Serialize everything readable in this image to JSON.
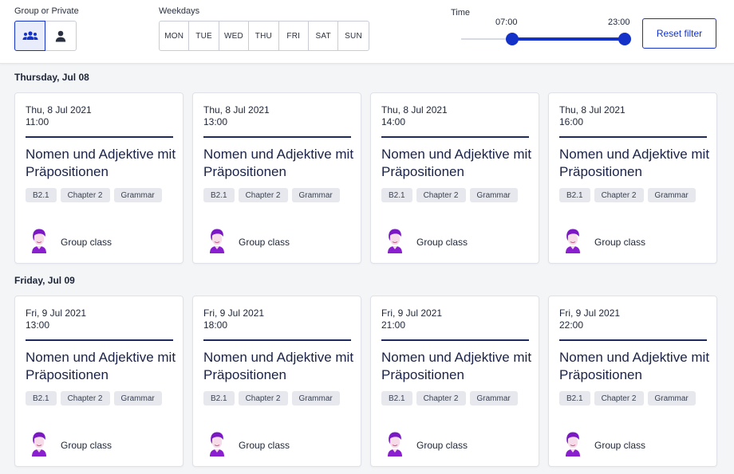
{
  "filters": {
    "group_label": "Group or Private",
    "weekdays_label": "Weekdays",
    "weekdays": [
      "MON",
      "TUE",
      "WED",
      "THU",
      "FRI",
      "SAT",
      "SUN"
    ],
    "time_label": "Time",
    "time_start": "07:00",
    "time_end": "23:00",
    "reset_label": "Reset filter"
  },
  "days": [
    {
      "heading": "Thursday, Jul 08",
      "cards": [
        {
          "date": "Thu, 8 Jul 2021",
          "time": "11:00",
          "title": "Nomen und Adjektive mit Präpositionen",
          "tags": [
            "B2.1",
            "Chapter 2",
            "Grammar"
          ],
          "kind": "Group class"
        },
        {
          "date": "Thu, 8 Jul 2021",
          "time": "13:00",
          "title": "Nomen und Adjektive mit Präpositionen",
          "tags": [
            "B2.1",
            "Chapter 2",
            "Grammar"
          ],
          "kind": "Group class"
        },
        {
          "date": "Thu, 8 Jul 2021",
          "time": "14:00",
          "title": "Nomen und Adjektive mit Präpositionen",
          "tags": [
            "B2.1",
            "Chapter 2",
            "Grammar"
          ],
          "kind": "Group class"
        },
        {
          "date": "Thu, 8 Jul 2021",
          "time": "16:00",
          "title": "Nomen und Adjektive mit Präpositionen",
          "tags": [
            "B2.1",
            "Chapter 2",
            "Grammar"
          ],
          "kind": "Group class"
        }
      ]
    },
    {
      "heading": "Friday, Jul 09",
      "cards": [
        {
          "date": "Fri, 9 Jul 2021",
          "time": "13:00",
          "title": "Nomen und Adjektive mit Präpositionen",
          "tags": [
            "B2.1",
            "Chapter 2",
            "Grammar"
          ],
          "kind": "Group class"
        },
        {
          "date": "Fri, 9 Jul 2021",
          "time": "18:00",
          "title": "Nomen und Adjektive mit Präpositionen",
          "tags": [
            "B2.1",
            "Chapter 2",
            "Grammar"
          ],
          "kind": "Group class"
        },
        {
          "date": "Fri, 9 Jul 2021",
          "time": "21:00",
          "title": "Nomen und Adjektive mit Präpositionen",
          "tags": [
            "B2.1",
            "Chapter 2",
            "Grammar"
          ],
          "kind": "Group class"
        },
        {
          "date": "Fri, 9 Jul 2021",
          "time": "22:00",
          "title": "Nomen und Adjektive mit Präpositionen",
          "tags": [
            "B2.1",
            "Chapter 2",
            "Grammar"
          ],
          "kind": "Group class"
        }
      ]
    }
  ],
  "colors": {
    "accent": "#1432c8",
    "rule": "#1e2a5e",
    "avatar": "#8a1fcf"
  },
  "icons": {
    "group": "group-icon",
    "private": "person-icon",
    "teacher": "teacher-avatar"
  }
}
